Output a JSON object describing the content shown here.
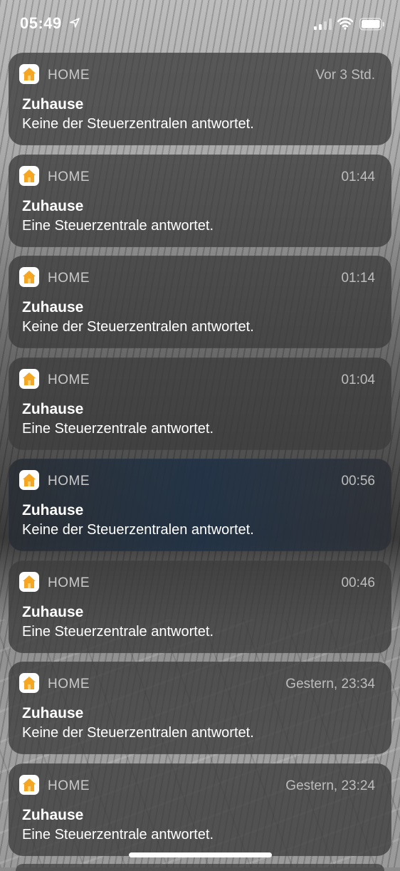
{
  "status_bar": {
    "time": "05:49",
    "icons": [
      "location-arrow-icon",
      "cellular-signal-icon",
      "wifi-icon",
      "battery-icon"
    ]
  },
  "notifications": [
    {
      "app": "HOME",
      "time": "Vor 3 Std.",
      "title": "Zuhause",
      "body": "Keine der Steuerzentralen antwortet."
    },
    {
      "app": "HOME",
      "time": "01:44",
      "title": "Zuhause",
      "body": "Eine Steuerzentrale antwortet."
    },
    {
      "app": "HOME",
      "time": "01:14",
      "title": "Zuhause",
      "body": "Keine der Steuerzentralen antwortet."
    },
    {
      "app": "HOME",
      "time": "01:04",
      "title": "Zuhause",
      "body": "Eine Steuerzentrale antwortet."
    },
    {
      "app": "HOME",
      "time": "00:56",
      "title": "Zuhause",
      "body": "Keine der Steuerzentralen antwortet."
    },
    {
      "app": "HOME",
      "time": "00:46",
      "title": "Zuhause",
      "body": "Eine Steuerzentrale antwortet."
    },
    {
      "app": "HOME",
      "time": "Gestern, 23:34",
      "title": "Zuhause",
      "body": "Keine der Steuerzentralen antwortet."
    },
    {
      "app": "HOME",
      "time": "Gestern, 23:24",
      "title": "Zuhause",
      "body": "Eine Steuerzentrale antwortet."
    }
  ],
  "colors": {
    "card_background": "#3c3c3c",
    "home_icon_orange": "#f5a623"
  }
}
